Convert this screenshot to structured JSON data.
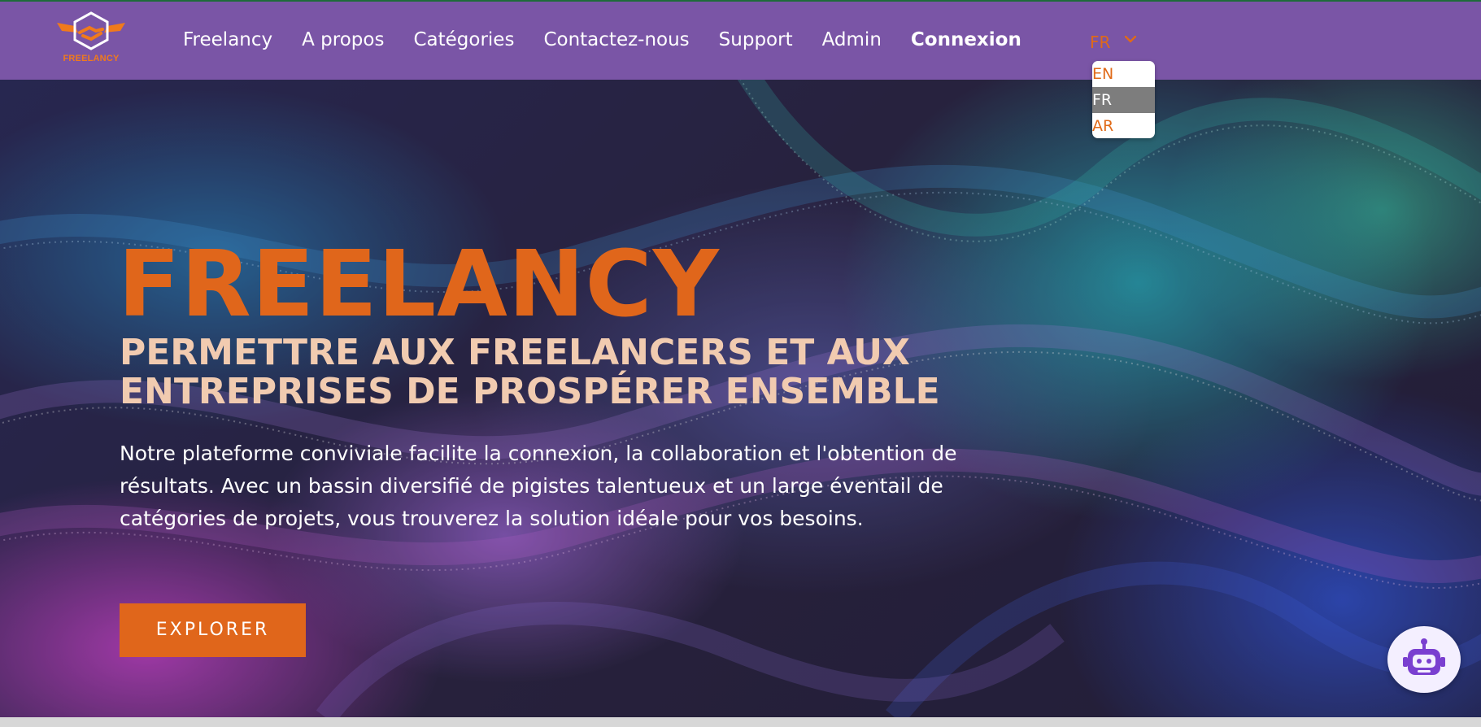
{
  "brand": {
    "name": "FREELANCY",
    "logo_icon": "handshake-hexagon-logo",
    "accent_color": "#e0661b",
    "nav_color": "#7a55a6"
  },
  "nav": {
    "links": [
      "Freelancy",
      "A propos",
      "Catégories",
      "Contactez-nous",
      "Support",
      "Admin"
    ],
    "login": "Connexion",
    "language": {
      "current": "FR",
      "options": [
        "EN",
        "FR",
        "AR"
      ],
      "selected": "FR"
    }
  },
  "hero": {
    "title": "FREELANCY",
    "subtitle": "PERMETTRE AUX FREELANCERS ET AUX ENTREPRISES DE PROSPÉRER ENSEMBLE",
    "description": "Notre plateforme conviviale facilite la connexion, la collaboration et l'obtention de résultats. Avec un bassin diversifié de pigistes talentueux et un large éventail de catégories de projets, vous trouverez la solution idéale pour vos besoins.",
    "cta": "EXPLORER"
  },
  "chatbot": {
    "icon": "robot-icon"
  }
}
